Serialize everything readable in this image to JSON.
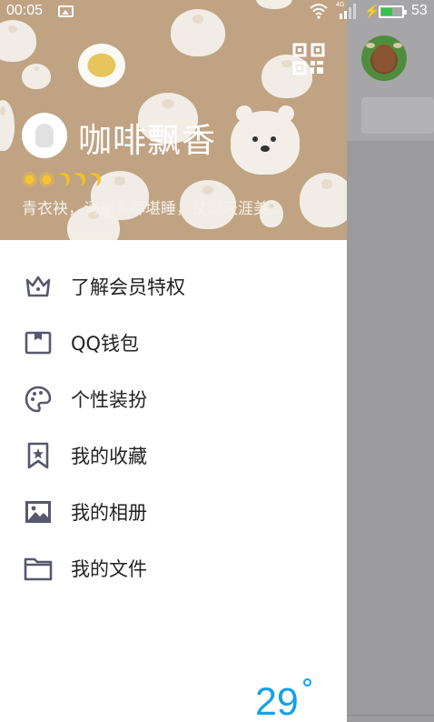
{
  "status_bar": {
    "time": "00:05",
    "network_label": "4G",
    "battery_level": 0.53,
    "battery_percent": "53"
  },
  "profile": {
    "nickname": "咖啡飘香",
    "signature": "青衣袂，词嘲墨尽堪睡，仗剑天涯美.."
  },
  "menu": {
    "items": [
      {
        "label": "了解会员特权",
        "icon": "crown-icon"
      },
      {
        "label": "QQ钱包",
        "icon": "wallet-icon"
      },
      {
        "label": "个性装扮",
        "icon": "palette-icon"
      },
      {
        "label": "我的收藏",
        "icon": "bookmark-star-icon"
      },
      {
        "label": "我的相册",
        "icon": "image-icon"
      },
      {
        "label": "我的文件",
        "icon": "folder-icon"
      }
    ]
  },
  "weather": {
    "temperature": "29"
  },
  "colors": {
    "header_bg": "#c0a383",
    "icon_stroke": "#56586f",
    "weather_blue": "#15a1e6",
    "overlay_gray": "#9b9b9d"
  }
}
